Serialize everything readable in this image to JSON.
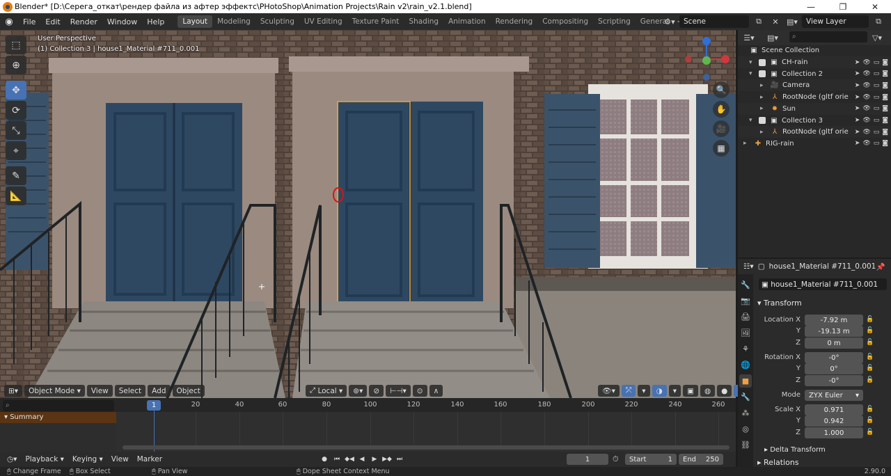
{
  "window": {
    "title": "Blender* [D:\\Серега_откат\\рендер файла из афтер эффектс\\PHotoShop\\Animation Projects\\Rain v2\\rain_v2.1.blend]",
    "minimize": "—",
    "maximize": "❐",
    "close": "✕"
  },
  "menu": [
    "File",
    "Edit",
    "Render",
    "Window",
    "Help"
  ],
  "workspaces": [
    "Layout",
    "Modeling",
    "Sculpting",
    "UV Editing",
    "Texture Paint",
    "Shading",
    "Animation",
    "Rendering",
    "Compositing",
    "Scripting",
    "General"
  ],
  "active_workspace": "Layout",
  "scene": {
    "name": "Scene",
    "view_layer": "View Layer"
  },
  "viewport": {
    "perspective": "User Perspective",
    "collection_info": "(1) Collection 3 | house1_Material #711_0.001",
    "header": {
      "mode": "Object Mode",
      "view": "View",
      "select": "Select",
      "add": "Add",
      "object": "Object",
      "orientation": "Local"
    }
  },
  "colors": {
    "accent": "#4772b3",
    "selection": "#f5a623",
    "summary": "#5a3413",
    "object_active": "#f0a040"
  },
  "timeline": {
    "search_placeholder": "⌕",
    "summary": "Summary",
    "current_frame": "1",
    "ticks": [
      "20",
      "40",
      "60",
      "80",
      "100",
      "120",
      "140",
      "160",
      "180",
      "200",
      "220",
      "240",
      "260"
    ]
  },
  "playback": {
    "playback": "Playback",
    "keying": "Keying",
    "view": "View",
    "marker": "Marker",
    "frame": "1",
    "start_label": "Start",
    "start": "1",
    "end_label": "End",
    "end": "250"
  },
  "outliner": {
    "root": "Scene Collection",
    "rows": [
      {
        "name": "CH-rain",
        "icon": "collection-icon",
        "glyph": "▣",
        "checked": true
      },
      {
        "name": "Collection 2",
        "icon": "collection-icon",
        "glyph": "▣",
        "checked": true
      },
      {
        "name": "Camera",
        "icon": "camera-icon",
        "glyph": "🎥",
        "checked": false
      },
      {
        "name": "RootNode (gltf orie",
        "icon": "empty-icon",
        "glyph": "⅄",
        "checked": false
      },
      {
        "name": "Sun",
        "icon": "light-icon",
        "glyph": "✹",
        "checked": false
      },
      {
        "name": "Collection 3",
        "icon": "collection-icon",
        "glyph": "▣",
        "checked": true
      },
      {
        "name": "RootNode (gltf orie",
        "icon": "empty-icon",
        "glyph": "⅄",
        "checked": false
      },
      {
        "name": "RIG-rain",
        "icon": "armature-icon",
        "glyph": "✚",
        "checked": false
      }
    ]
  },
  "properties": {
    "context": "house1_Material #711_0.001",
    "object_name": "house1_Material #711_0.001",
    "transform_title": "Transform",
    "location_label": "Location X",
    "location": [
      "-7.92 m",
      "-19.13 m",
      "0 m"
    ],
    "rotation_label": "Rotation X",
    "rotation": [
      "-0°",
      "0°",
      "-0°"
    ],
    "mode_label": "Mode",
    "mode": "ZYX Euler",
    "scale_label": "Scale X",
    "scale": [
      "0.971",
      "0.942",
      "1.000"
    ],
    "axis_y": "Y",
    "axis_z": "Z",
    "delta_transform": "Delta Transform",
    "relations": "Relations"
  },
  "status": {
    "change_frame": "Change Frame",
    "box_select": "Box Select",
    "pan_view": "Pan View",
    "context_menu": "Dope Sheet Context Menu",
    "version": "2.90.0"
  }
}
